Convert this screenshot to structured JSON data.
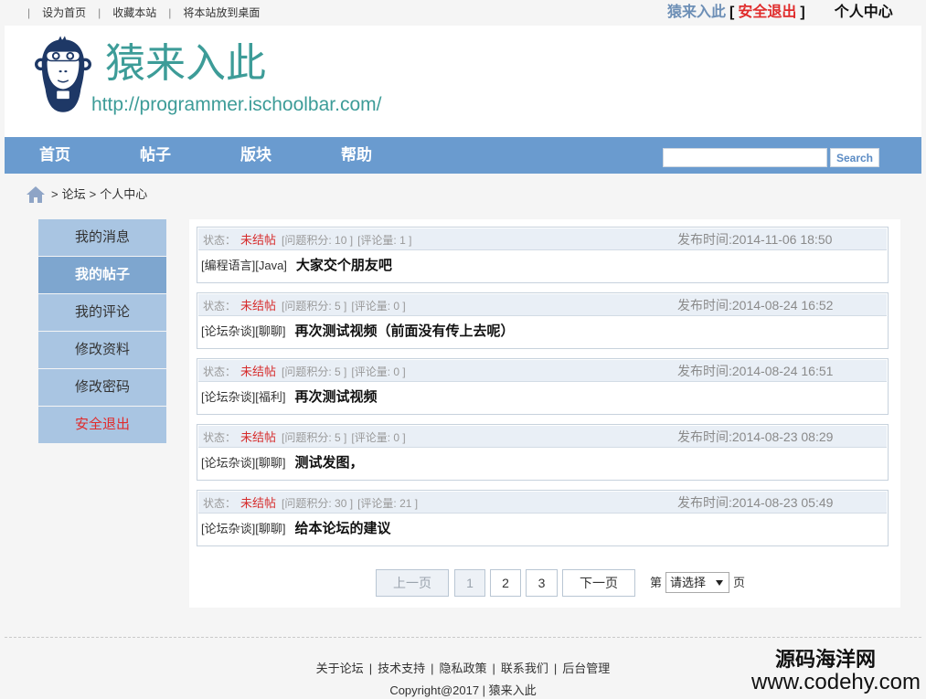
{
  "topbar": {
    "separator": "|",
    "links": [
      "设为首页",
      "收藏本站",
      "将本站放到桌面"
    ],
    "username": "猿来入此",
    "bracket_open": "[",
    "logout": "安全退出",
    "bracket_close": "]",
    "user_center": "个人中心"
  },
  "header": {
    "site_title": "猿来入此",
    "site_url": "http://programmer.ischoolbar.com/"
  },
  "nav": {
    "items": [
      "首页",
      "帖子",
      "版块",
      "帮助"
    ],
    "search_value": "",
    "search_button": "Search"
  },
  "breadcrumb": {
    "separator": ">",
    "items": [
      "论坛",
      "个人中心"
    ]
  },
  "sidebar": {
    "items": [
      "我的消息",
      "我的帖子",
      "我的评论",
      "修改资料",
      "修改密码",
      "安全退出"
    ],
    "active_index": 1
  },
  "posts": [
    {
      "status_label": "状态：",
      "status": "未结帖",
      "points": "[问题积分: 10 ]",
      "comments": "[评论量: 1 ]",
      "time": "发布时间:2014-11-06 18:50",
      "category": "[编程语言][Java]",
      "title": "大家交个朋友吧"
    },
    {
      "status_label": "状态：",
      "status": "未结帖",
      "points": "[问题积分: 5 ]",
      "comments": "[评论量: 0 ]",
      "time": "发布时间:2014-08-24 16:52",
      "category": "[论坛杂谈][聊聊]",
      "title": "再次测试视频（前面没有传上去呢）"
    },
    {
      "status_label": "状态：",
      "status": "未结帖",
      "points": "[问题积分: 5 ]",
      "comments": "[评论量: 0 ]",
      "time": "发布时间:2014-08-24 16:51",
      "category": "[论坛杂谈][福利]",
      "title": "再次测试视频"
    },
    {
      "status_label": "状态：",
      "status": "未结帖",
      "points": "[问题积分: 5 ]",
      "comments": "[评论量: 0 ]",
      "time": "发布时间:2014-08-23 08:29",
      "category": "[论坛杂谈][聊聊]",
      "title": "测试发图，"
    },
    {
      "status_label": "状态：",
      "status": "未结帖",
      "points": "[问题积分: 30 ]",
      "comments": "[评论量: 21 ]",
      "time": "发布时间:2014-08-23 05:49",
      "category": "[论坛杂谈][聊聊]",
      "title": "给本论坛的建议"
    }
  ],
  "pagination": {
    "prev": "上一页",
    "pages": [
      "1",
      "2",
      "3"
    ],
    "current_page": 1,
    "next": "下一页",
    "goto_prefix": "第",
    "select_value": "请选择",
    "goto_suffix": "页"
  },
  "footer": {
    "links": [
      "关于论坛",
      "技术支持",
      "隐私政策",
      "联系我们",
      "后台管理"
    ],
    "separator": "|",
    "copyright": "Copyright@2017 | 猿来入此"
  },
  "watermark": {
    "line1": "源码海洋网",
    "line2": "www.codehy.com"
  },
  "icons": {
    "logo": "monkey-logo-icon",
    "home": "home-icon",
    "select_arrow": "chevron-down-icon"
  },
  "colors": {
    "nav": "#6a9bcf",
    "sidebar": "#a9c5e2",
    "sidebar_active": "#7ea6cf",
    "brand_teal": "#3d9c98",
    "danger": "#e02b2b",
    "username": "#6d8fb6"
  }
}
